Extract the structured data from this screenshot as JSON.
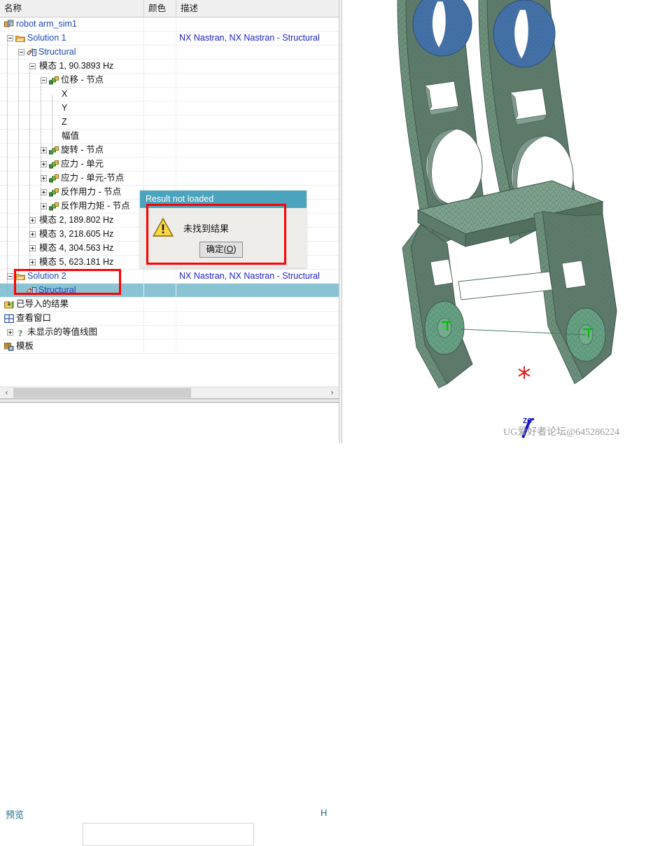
{
  "columns": {
    "name": "名称",
    "color": "颜色",
    "description": "描述"
  },
  "tree": {
    "rows": [
      {
        "id": "robot-arm-sim1",
        "label": "robot arm_sim1",
        "indent": 0,
        "icon": "assembly-icon",
        "expander": null,
        "color": "blue",
        "desc": "",
        "selected": false
      },
      {
        "id": "solution-1",
        "label": "Solution 1",
        "indent": 1,
        "icon": "folder-icon",
        "expander": "minus",
        "color": "blue",
        "desc": "NX Nastran, NX Nastran - Structural",
        "selected": false
      },
      {
        "id": "structural-1",
        "label": "Structural",
        "indent": 2,
        "icon": "structural-icon",
        "expander": "minus",
        "color": "blue",
        "desc": "",
        "selected": false
      },
      {
        "id": "mode-1",
        "label": "模态 1, 90.3893 Hz",
        "indent": 3,
        "icon": null,
        "expander": "minus",
        "color": "black",
        "desc": "",
        "selected": false
      },
      {
        "id": "displacement-nodal",
        "label": "位移 - 节点",
        "indent": 4,
        "icon": "result-icon",
        "expander": "minus",
        "color": "black",
        "desc": "",
        "selected": false
      },
      {
        "id": "disp-x",
        "label": "X",
        "indent": 5,
        "icon": null,
        "expander": null,
        "color": "black",
        "desc": "",
        "selected": false
      },
      {
        "id": "disp-y",
        "label": "Y",
        "indent": 5,
        "icon": null,
        "expander": null,
        "color": "black",
        "desc": "",
        "selected": false
      },
      {
        "id": "disp-z",
        "label": "Z",
        "indent": 5,
        "icon": null,
        "expander": null,
        "color": "black",
        "desc": "",
        "selected": false
      },
      {
        "id": "disp-magnitude",
        "label": "幅值",
        "indent": 5,
        "icon": null,
        "expander": null,
        "color": "black",
        "desc": "",
        "selected": false
      },
      {
        "id": "rotation-nodal",
        "label": "旋转 - 节点",
        "indent": 4,
        "icon": "result-icon",
        "expander": "plus",
        "color": "black",
        "desc": "",
        "selected": false
      },
      {
        "id": "stress-elemental",
        "label": "应力 - 单元",
        "indent": 4,
        "icon": "result-icon",
        "expander": "plus",
        "color": "black",
        "desc": "",
        "selected": false
      },
      {
        "id": "stress-elem-nodal",
        "label": "应力 - 单元-节点",
        "indent": 4,
        "icon": "result-icon",
        "expander": "plus",
        "color": "black",
        "desc": "",
        "selected": false
      },
      {
        "id": "reaction-force-nodal",
        "label": "反作用力 - 节点",
        "indent": 4,
        "icon": "result-icon",
        "expander": "plus",
        "color": "black",
        "desc": "",
        "selected": false
      },
      {
        "id": "reaction-moment-nodal",
        "label": "反作用力矩 - 节点",
        "indent": 4,
        "icon": "result-icon",
        "expander": "plus",
        "color": "black",
        "desc": "",
        "selected": false
      },
      {
        "id": "mode-2",
        "label": "模态 2, 189.802 Hz",
        "indent": 3,
        "icon": null,
        "expander": "plus",
        "color": "black",
        "desc": "",
        "selected": false
      },
      {
        "id": "mode-3",
        "label": "模态 3, 218.605 Hz",
        "indent": 3,
        "icon": null,
        "expander": "plus",
        "color": "black",
        "desc": "",
        "selected": false
      },
      {
        "id": "mode-4",
        "label": "模态 4, 304.563 Hz",
        "indent": 3,
        "icon": null,
        "expander": "plus",
        "color": "black",
        "desc": "",
        "selected": false
      },
      {
        "id": "mode-5",
        "label": "模态 5, 623.181 Hz",
        "indent": 3,
        "icon": null,
        "expander": "plus",
        "color": "black",
        "desc": "",
        "selected": false
      },
      {
        "id": "solution-2",
        "label": "Solution 2",
        "indent": 1,
        "icon": "folder-icon",
        "expander": "minus",
        "color": "blue",
        "desc": "NX Nastran, NX Nastran - Structural",
        "selected": false
      },
      {
        "id": "structural-2",
        "label": "Structural",
        "indent": 2,
        "icon": "structural-icon",
        "expander": null,
        "color": "blue",
        "desc": "",
        "selected": true
      },
      {
        "id": "imported-results",
        "label": "已导入的结果",
        "indent": 0,
        "icon": "import-icon",
        "expander": null,
        "color": "black",
        "desc": "",
        "selected": false
      },
      {
        "id": "view-windows",
        "label": "查看窗口",
        "indent": 0,
        "icon": "window-icon",
        "expander": null,
        "color": "black",
        "desc": "",
        "selected": false
      },
      {
        "id": "undisplayed-contour",
        "label": "未显示的等值线图",
        "indent": 1,
        "icon": "question-icon",
        "expander": "plus",
        "color": "black",
        "desc": "",
        "selected": false
      },
      {
        "id": "templates",
        "label": "模板",
        "indent": 0,
        "icon": "template-icon",
        "expander": null,
        "color": "black",
        "desc": "",
        "selected": false
      }
    ]
  },
  "scrollbar": {
    "left_arrow": "‹",
    "right_arrow": "›"
  },
  "preview": {
    "title": "预览",
    "handle_label": "H"
  },
  "dialog": {
    "title": "Result not loaded",
    "message": "未找到结果",
    "ok_prefix": "确定(",
    "ok_mnemonic": "O",
    "ok_suffix": ")",
    "icon": "warning-icon",
    "title_bar_color": "#4ba3bd",
    "annotation_color": "#ff0000"
  },
  "viewport": {
    "watermark": "UG爱好者论坛@645286224",
    "triad_label": "ZC",
    "mesh_color": "#5f7a6d",
    "mesh_face_color": "#6e8c7c",
    "mesh_highlight_color": "#4472a8",
    "background": "#ffffff"
  }
}
